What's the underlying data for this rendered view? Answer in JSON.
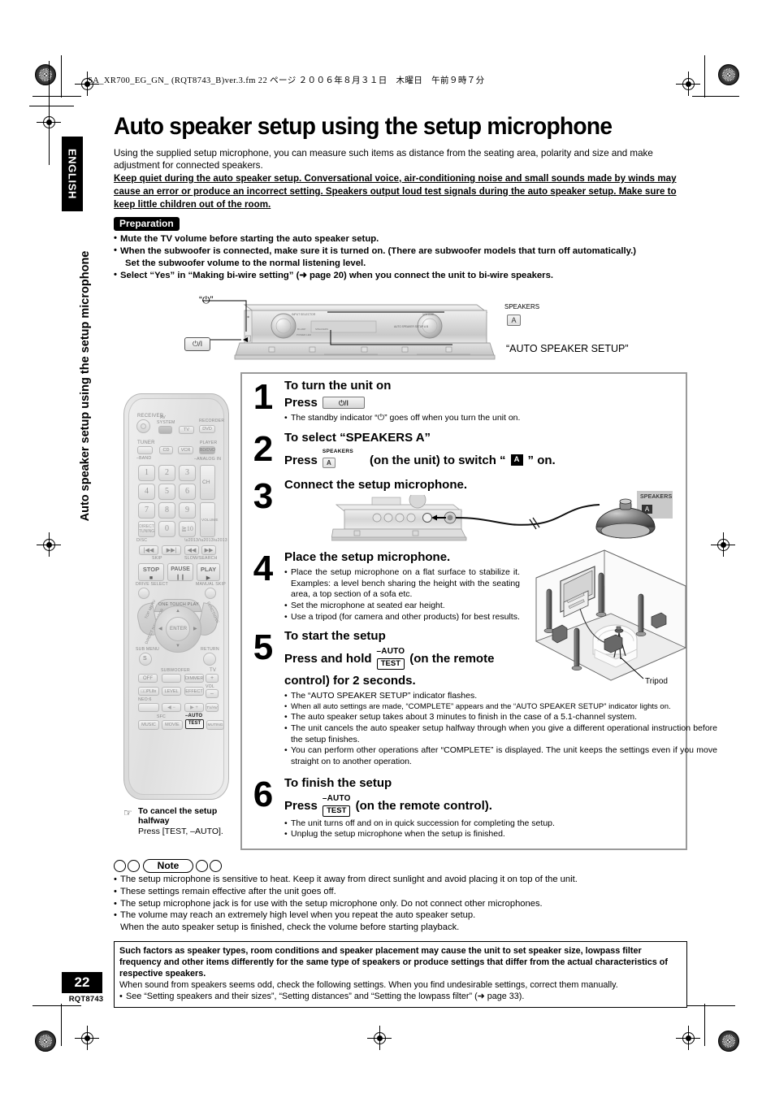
{
  "file_header": "SA_XR700_EG_GN_ (RQT8743_B)ver.3.fm  22 ページ  ２００６年８月３１日　木曜日　午前９時７分",
  "sidebar": {
    "language_tab": "ENGLISH",
    "vertical_title": "Auto speaker setup using the setup microphone",
    "page_number": "22",
    "page_code": "RQT8743"
  },
  "title": "Auto speaker setup using the setup microphone",
  "intro": "Using the supplied setup microphone, you can measure such items as distance from the seating area, polarity and size and make adjustment for connected speakers.",
  "warning": "Keep quiet during the auto speaker setup. Conversational voice, air-conditioning noise and small sounds made by winds may cause an error or produce an incorrect setting. Speakers output loud test signals during the auto speaker setup. Make sure to keep little children out of the room.",
  "preparation": {
    "badge": "Preparation",
    "items": [
      "Mute the TV volume before starting the auto speaker setup.",
      "When the subwoofer is connected, make sure it is turned on. (There are subwoofer models that turn off automatically.)",
      "Set the subwoofer volume to the normal listening level.",
      "Select “Yes”  in “Making bi-wire setting” (➜ page 20) when you connect the unit to bi-wire speakers."
    ]
  },
  "receiver_diagram": {
    "standby_label": "“⏻”",
    "power_key": "⏻/I",
    "speakers_label": "SPEAKERS",
    "speakers_key": "A",
    "auto_setup_label": "“AUTO SPEAKER SETUP”"
  },
  "steps": [
    {
      "num": "1",
      "heading": "To turn the unit on",
      "press_prefix": "Press",
      "key": "⏻/I",
      "notes": [
        "The standby indicator “⏻” goes off when you turn the unit on."
      ]
    },
    {
      "num": "2",
      "heading": "To select “SPEAKERS A”",
      "press_prefix": "Press",
      "key_label": "SPEAKERS",
      "key": "A",
      "press_suffix_a": "(on the unit) to switch “",
      "press_suffix_b": "” on.",
      "display_label": "SPEAKERS",
      "display_value": "A",
      "notes": []
    },
    {
      "num": "3",
      "heading": "Connect the setup microphone.",
      "notes": []
    },
    {
      "num": "4",
      "heading": "Place the setup microphone.",
      "notes": [
        "Place the setup microphone on a flat surface to stabilize it. Examples: a level bench sharing the height with the seating area, a top section of a sofa etc.",
        "Set the microphone at seated ear height.",
        "Use a tripod (for camera and other products) for best results."
      ],
      "tripod_label": "Tripod"
    },
    {
      "num": "5",
      "heading": "To start the setup",
      "press_prefix": "Press and hold",
      "key_top": "–AUTO",
      "key_bottom": "TEST",
      "press_mid": "(on the remote",
      "press_end": "control) for 2 seconds.",
      "notes": [
        "The “AUTO SPEAKER SETUP” indicator flashes.",
        "When all auto settings are made, “COMPLETE” appears and the “AUTO SPEAKER SETUP” indicator lights on.",
        "The auto speaker setup takes about 3 minutes to finish in the case of a 5.1-channel system.",
        "The unit cancels the auto speaker setup halfway through when you give a different operational instruction before the setup finishes.",
        "You can perform other operations after “COMPLETE” is displayed. The unit keeps the settings even if you move straight on to another operation."
      ]
    },
    {
      "num": "6",
      "heading": "To finish the setup",
      "press_prefix": "Press",
      "key_top": "–AUTO",
      "key_bottom": "TEST",
      "press_suffix": "(on the remote control).",
      "notes": [
        "The unit turns off and on in quick succession for completing the setup.",
        "Unplug the setup microphone when the setup is finished."
      ]
    }
  ],
  "cancel": {
    "heading_line1": "To cancel the setup",
    "heading_line2": "halfway",
    "body": "Press [TEST, –AUTO]."
  },
  "note_section": {
    "label": "Note",
    "items": [
      "The setup microphone is sensitive to heat. Keep it away from direct sunlight and avoid placing it on top of the unit.",
      "These settings remain effective after the unit goes off.",
      "The setup microphone jack is for use with the setup microphone only. Do not connect other microphones.",
      "The volume may reach an extremely high level when you repeat the auto speaker setup.",
      "When the auto speaker setup is finished, check the volume before starting playback."
    ]
  },
  "bottom_box": {
    "bold_text": "Such factors as speaker types, room conditions and speaker placement may cause the unit to set speaker size, lowpass filter frequency and other items differently for the same type of speakers or produce settings that differ from the actual characteristics of respective speakers.",
    "text": "When sound from speakers seems odd, check the following settings. When you find undesirable settings, correct them manually.",
    "bullet": "See “Setting speakers and their sizes”, “Setting distances” and “Setting the lowpass filter” (➜ page 33)."
  },
  "remote": {
    "labels": {
      "receiver": "RECEIVER",
      "av_system": "AV SYSTEM",
      "tv": "TV",
      "recorder": "RECORDER",
      "dvd": "DVD",
      "tuner": "TUNER",
      "band": "–BAND",
      "cd": "CD",
      "vcr": "VCR",
      "player": "PLAYER",
      "bd_dvd": "BD/DVD",
      "analog_in": "–ANALOG IN",
      "ch": "CH",
      "volume": "VOLUME",
      "direct_tuning": "DIRECT TUNING",
      "disc": "DISC",
      "ten": "≧10",
      "skip": "SKIP",
      "slow_search": "SLOW/SEARCH",
      "stop": "STOP",
      "pause": "PAUSE",
      "play": "PLAY",
      "drive_select": "DRIVE SELECT",
      "manual_skip": "MANUAL SKIP",
      "one_touch_play": "ONE TOUCH PLAY",
      "top_menu": "TOP MENU",
      "direct_navigator": "DIRECT NAVIGATOR",
      "functions": "FUNCTIONS",
      "enter": "ENTER",
      "sub_menu": "SUB MENU",
      "sub_menu_key": "S",
      "return": "RETURN",
      "off": "OFF",
      "subwoofer": "SUBWOOFER",
      "dimmer": "DIMMER",
      "tv_grp": "TV",
      "plus": "+",
      "minus": "–",
      "vol": "VOL",
      "plii": "□□PLⅡx",
      "level": "LEVEL",
      "effect": "EFFECT",
      "tv_av": "TV/AV",
      "neo6": "NEO:6",
      "sfc": "SFC",
      "music": "MUSIC",
      "movie": "MOVIE",
      "auto": "–AUTO",
      "test": "TEST",
      "muting": "MUTING",
      "numbers": [
        "1",
        "2",
        "3",
        "4",
        "5",
        "6",
        "7",
        "8",
        "9",
        "0"
      ]
    }
  }
}
